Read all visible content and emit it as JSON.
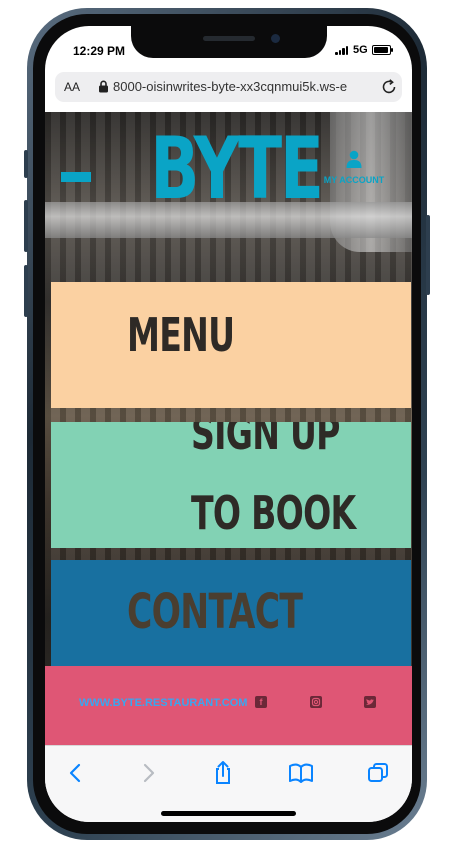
{
  "status_bar": {
    "time": "12:29 PM",
    "network": "5G"
  },
  "browser": {
    "text_size_label": "AA",
    "url": "8000-oisinwrites-byte-xx3cqnmui5k.ws-e"
  },
  "site": {
    "logo": "BYTE",
    "account_label": "MY ACCOUNT",
    "tiles": {
      "menu": "MENU",
      "signup_line1": "SIGN UP",
      "signup_line2": "TO BOOK",
      "contact": "CONTACT"
    },
    "footer": {
      "link": "WWW.BYTE.RESTAURANT.COM"
    }
  },
  "icons": {
    "lock": "lock-icon",
    "reload": "reload-icon",
    "account": "user-icon",
    "facebook": "facebook-icon",
    "instagram": "instagram-icon",
    "twitter": "twitter-icon",
    "back": "back-icon",
    "forward": "forward-icon",
    "share": "share-icon",
    "bookmarks": "bookmarks-icon",
    "tabs": "tabs-icon"
  },
  "colors": {
    "brand": "#0aa4c6",
    "menu_tile": "#fbd1a2",
    "signup_tile": "#82d2b4",
    "contact_tile": "#1870a0",
    "footer": "#df5675",
    "ios_blue": "#0a84ff"
  }
}
